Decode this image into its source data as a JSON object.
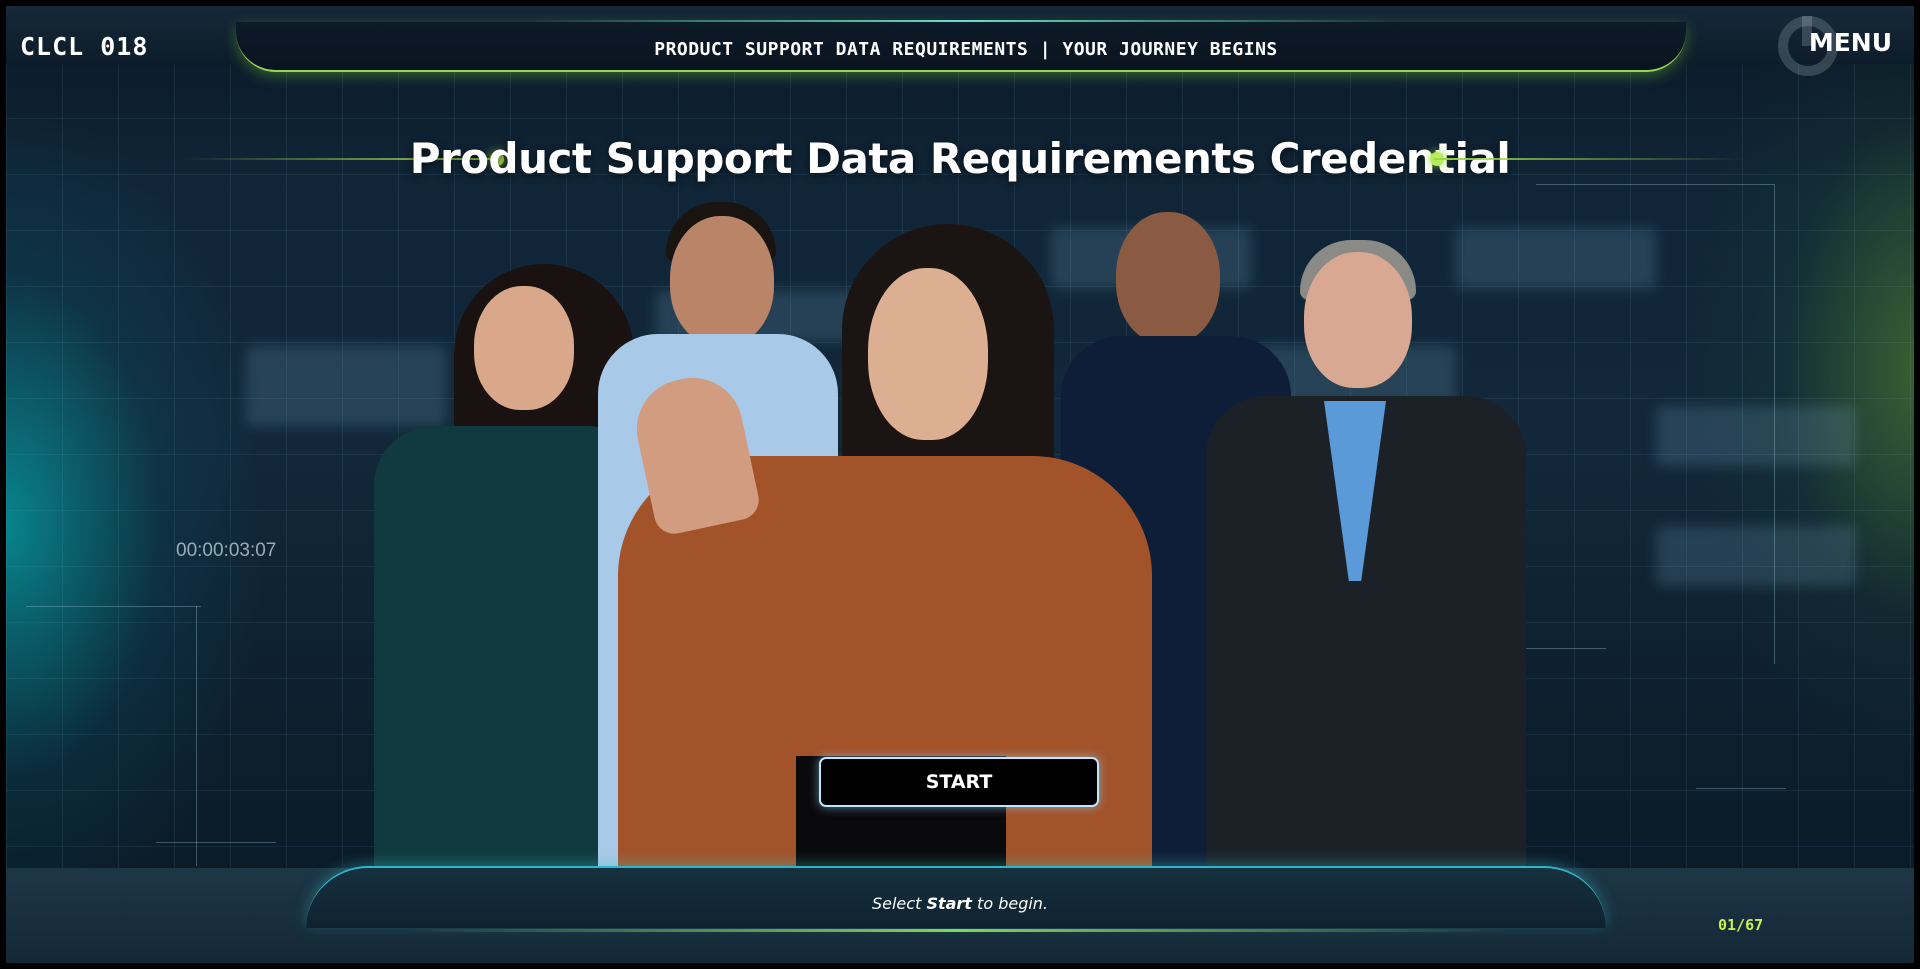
{
  "header": {
    "course_code": "CLCL 018",
    "module_title": "PRODUCT SUPPORT DATA REQUIREMENTS | YOUR JOURNEY BEGINS",
    "menu_label": "MENU"
  },
  "main": {
    "heading": "Product Support Data Requirements Credential",
    "timecode": "00:00:03:07",
    "start_label": "START"
  },
  "footer": {
    "instruction_prefix": "Select ",
    "instruction_emphasis": "Start",
    "instruction_suffix": " to begin.",
    "page_counter": "01/67"
  },
  "colors": {
    "accent_green": "#9ad64b",
    "accent_teal": "#2fb5c9",
    "counter": "#c8ef52"
  }
}
